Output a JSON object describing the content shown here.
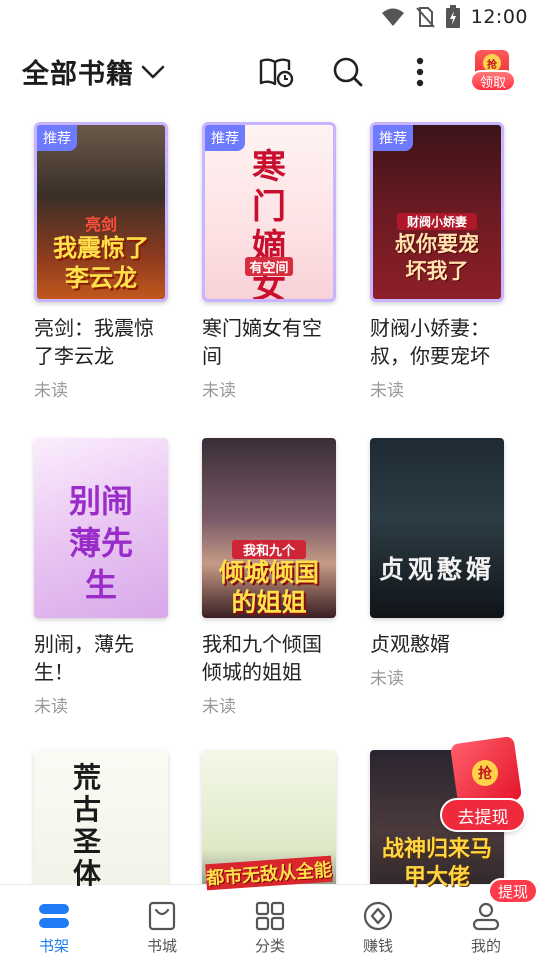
{
  "status_bar": {
    "time": "12:00"
  },
  "header": {
    "title": "全部书籍",
    "reward_badge": "领取",
    "reward_coin": "抢"
  },
  "books": [
    {
      "title": "亮剑：我震惊了李云龙",
      "status": "未读",
      "tag": "推荐",
      "cover_text": "我震惊了李云龙",
      "cover_top": "亮剑"
    },
    {
      "title": "寒门嫡女有空间",
      "status": "未读",
      "tag": "推荐",
      "cover_text": "寒门嫡女",
      "cover_top": "有空间"
    },
    {
      "title": "财阀小娇妻：叔，你要宠坏",
      "status": "未读",
      "tag": "推荐",
      "cover_text": "叔你要宠坏我了",
      "cover_top": "财阀小娇妻"
    },
    {
      "title": "别闹，薄先生！",
      "status": "未读",
      "tag": "",
      "cover_text": "别闹薄先生",
      "cover_top": ""
    },
    {
      "title": "我和九个倾国倾城的姐姐",
      "status": "未读",
      "tag": "",
      "cover_text": "倾城倾国的姐姐",
      "cover_top": "我和九个"
    },
    {
      "title": "贞观憨婿",
      "status": "未读",
      "tag": "",
      "cover_text": "贞观憨婿",
      "cover_top": ""
    },
    {
      "title": "",
      "status": "",
      "tag": "",
      "cover_text": "荒古圣体",
      "cover_top": ""
    },
    {
      "title": "",
      "status": "",
      "tag": "",
      "cover_text": "都市无敌从全能",
      "cover_top": ""
    },
    {
      "title": "",
      "status": "",
      "tag": "",
      "cover_text": "战神归来马甲大佬",
      "cover_top": ""
    }
  ],
  "floating_reward": {
    "coin": "抢",
    "label": "去提现"
  },
  "nav": {
    "items": [
      {
        "label": "书架",
        "icon": "bookshelf-icon"
      },
      {
        "label": "书城",
        "icon": "bag-icon"
      },
      {
        "label": "分类",
        "icon": "grid-icon"
      },
      {
        "label": "赚钱",
        "icon": "coin-icon"
      },
      {
        "label": "我的",
        "icon": "person-icon"
      }
    ],
    "active": "书架",
    "withdraw_badge": "提现"
  },
  "colors": {
    "accent": "#1f7cf4",
    "tag": "#6e7bff",
    "red": "#ee2a3c"
  }
}
